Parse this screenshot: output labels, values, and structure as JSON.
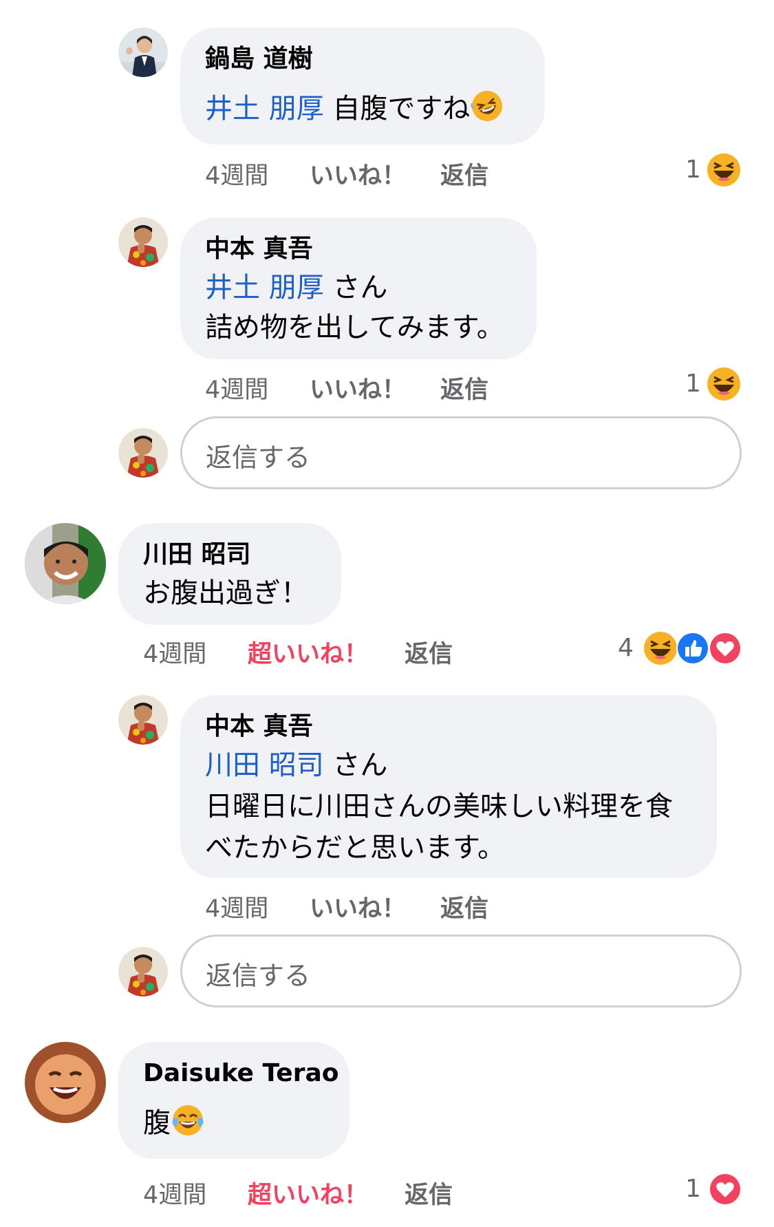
{
  "comments": [
    {
      "author": "鍋島 道樹",
      "mention": "井土 朋厚",
      "text": " 自腹ですね",
      "time": "4週間",
      "like": "いいね！",
      "reply": "返信",
      "reaction_count": "1",
      "emoji": "rofl-emoji"
    },
    {
      "author": "中本 真吾",
      "mention": "井土 朋厚",
      "mention_suffix": " さん",
      "text": "詰め物を出してみます。",
      "time": "4週間",
      "like": "いいね！",
      "reply": "返信",
      "reaction_count": "1"
    },
    {
      "author": "川田 昭司",
      "text": "お腹出過ぎ！",
      "time": "4週間",
      "like": "超いいね！",
      "reply": "返信",
      "reaction_count": "4"
    },
    {
      "author": "中本 真吾",
      "mention": "川田 昭司",
      "mention_suffix": " さん",
      "text_line1": "日曜日に川田さんの美味しい料理を食",
      "text_line2": "べたからだと思います。",
      "time": "4週間",
      "like": "いいね！",
      "reply": "返信"
    },
    {
      "author": "Daisuke Terao",
      "text": "腹",
      "time": "4週間",
      "like": "超いいね！",
      "reply": "返信",
      "reaction_count": "1",
      "emoji": "tears-of-joy-emoji"
    }
  ],
  "reply_box": {
    "placeholder": "返信する"
  },
  "colors": {
    "bubble": "#f0f2f5",
    "mention": "#1d5fc8",
    "meta": "#65676b",
    "love": "#f3425f",
    "like_blue": "#1877f2",
    "emoji_yellow": "#f7b125"
  }
}
